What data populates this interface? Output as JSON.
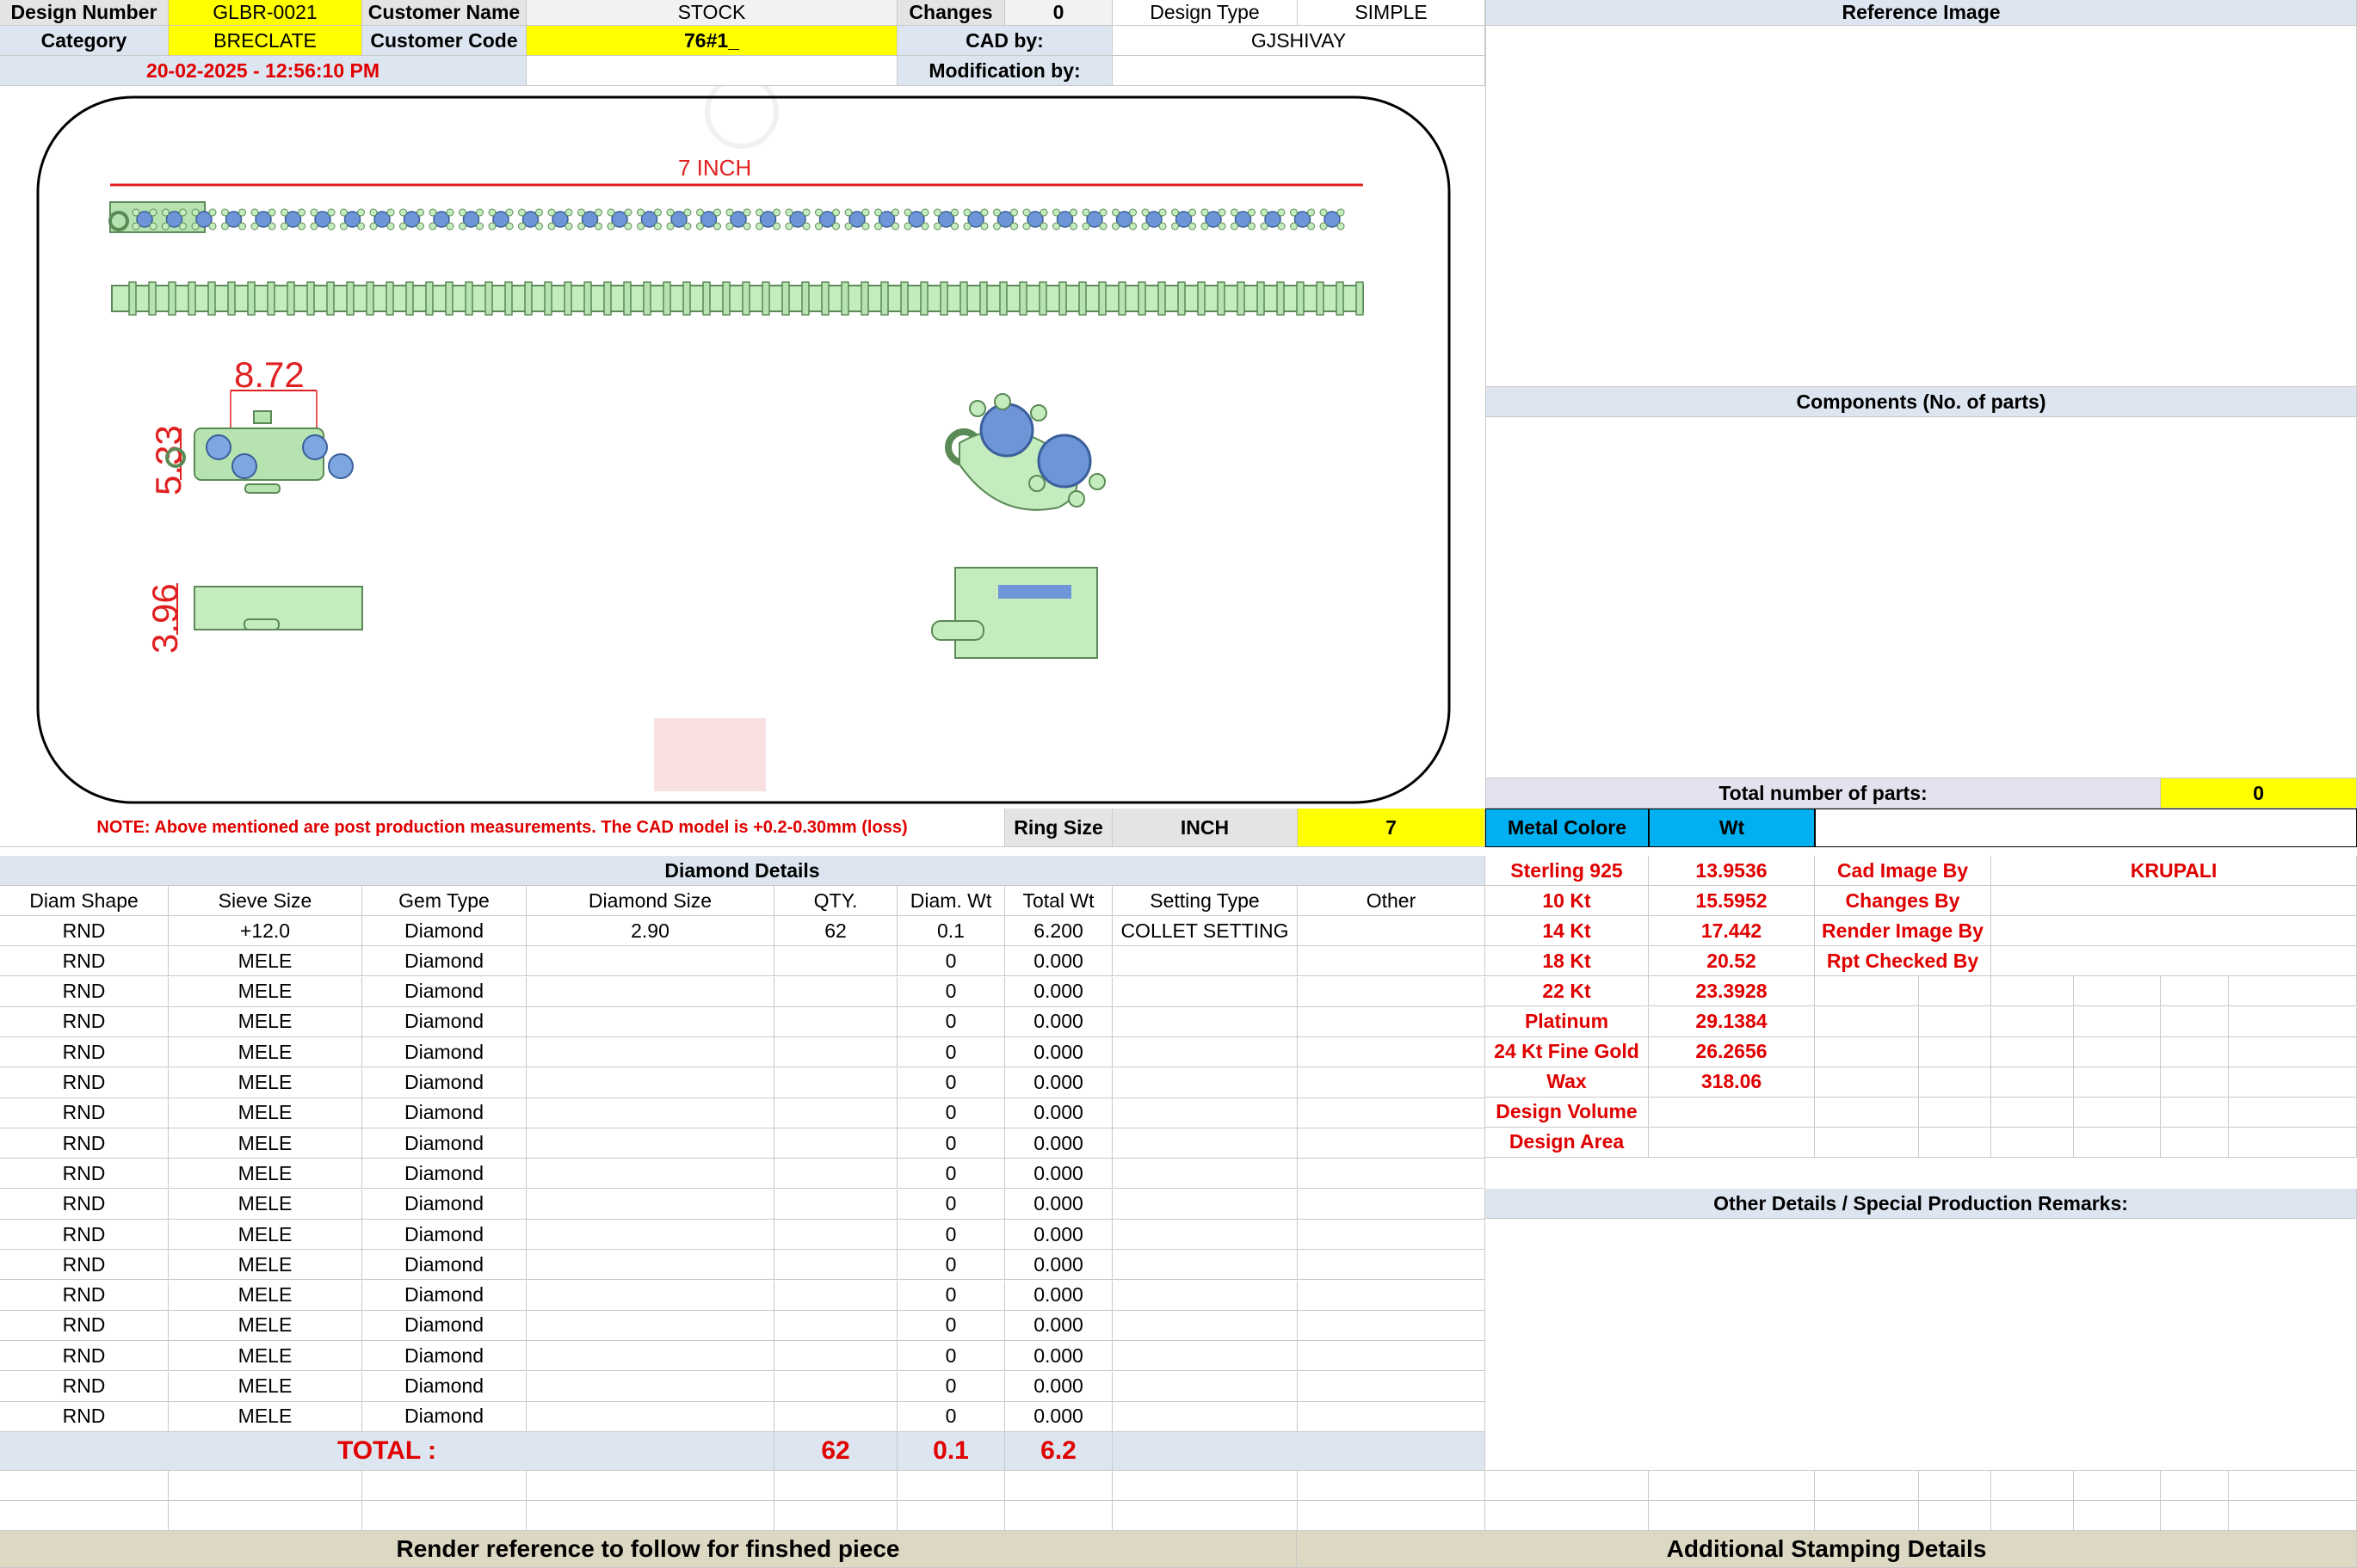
{
  "header": {
    "design_number_label": "Design Number",
    "design_number": "GLBR-0021",
    "customer_name_label": "Customer Name",
    "customer_name": "STOCK",
    "changes_label": "Changes",
    "changes": "0",
    "design_type_label": "Design Type",
    "design_type": "SIMPLE",
    "category_label": "Category",
    "category": "BRECLATE",
    "customer_code_label": "Customer Code",
    "customer_code": "76#1_",
    "cad_by_label": "CAD by:",
    "cad_by": "GJSHIVAY",
    "timestamp": "20-02-2025 - 12:56:10 PM",
    "modification_label": "Modification by:",
    "modification": ""
  },
  "right_panel": {
    "reference_image_title": "Reference Image",
    "components_title": "Components (No. of parts)",
    "total_parts_label": "Total number of parts:",
    "total_parts": "0"
  },
  "drawing": {
    "length_label": "7 INCH",
    "dim_width": "8.72",
    "dim_height": "5.33",
    "dim_thickness": "3.96"
  },
  "note": "NOTE: Above mentioned are post production measurements. The CAD model is +0.2-0.30mm (loss)",
  "ring_size": {
    "label": "Ring Size",
    "unit": "INCH",
    "value": "7"
  },
  "metal": {
    "header_color": "Metal Colore",
    "header_wt": "Wt",
    "rows": [
      {
        "name": "Sterling 925",
        "wt": "13.9536"
      },
      {
        "name": "10 Kt",
        "wt": "15.5952"
      },
      {
        "name": "14 Kt",
        "wt": "17.442"
      },
      {
        "name": "18 Kt",
        "wt": "20.52"
      },
      {
        "name": "22 Kt",
        "wt": "23.3928"
      },
      {
        "name": "Platinum",
        "wt": "29.1384"
      },
      {
        "name": "24 Kt Fine Gold",
        "wt": "26.2656"
      },
      {
        "name": "Wax",
        "wt": "318.06"
      },
      {
        "name": "Design Volume",
        "wt": ""
      },
      {
        "name": "Design Area",
        "wt": ""
      }
    ]
  },
  "credits": [
    {
      "label": "Cad Image By",
      "value": "KRUPALI"
    },
    {
      "label": "Changes By",
      "value": ""
    },
    {
      "label": "Render Image By",
      "value": ""
    },
    {
      "label": "Rpt Checked By",
      "value": ""
    }
  ],
  "other_details_title": "Other Details / Special Production Remarks:",
  "diamond": {
    "title": "Diamond Details",
    "columns": [
      "Diam Shape",
      "Sieve Size",
      "Gem Type",
      "Diamond Size",
      "QTY.",
      "Diam. Wt",
      "Total Wt",
      "Setting Type",
      "Other"
    ],
    "rows": [
      [
        "RND",
        "+12.0",
        "Diamond",
        "2.90",
        "62",
        "0.1",
        "6.200",
        "COLLET SETTING",
        ""
      ],
      [
        "RND",
        "MELE",
        "Diamond",
        "",
        "",
        "0",
        "0.000",
        "",
        ""
      ],
      [
        "RND",
        "MELE",
        "Diamond",
        "",
        "",
        "0",
        "0.000",
        "",
        ""
      ],
      [
        "RND",
        "MELE",
        "Diamond",
        "",
        "",
        "0",
        "0.000",
        "",
        ""
      ],
      [
        "RND",
        "MELE",
        "Diamond",
        "",
        "",
        "0",
        "0.000",
        "",
        ""
      ],
      [
        "RND",
        "MELE",
        "Diamond",
        "",
        "",
        "0",
        "0.000",
        "",
        ""
      ],
      [
        "RND",
        "MELE",
        "Diamond",
        "",
        "",
        "0",
        "0.000",
        "",
        ""
      ],
      [
        "RND",
        "MELE",
        "Diamond",
        "",
        "",
        "0",
        "0.000",
        "",
        ""
      ],
      [
        "RND",
        "MELE",
        "Diamond",
        "",
        "",
        "0",
        "0.000",
        "",
        ""
      ],
      [
        "RND",
        "MELE",
        "Diamond",
        "",
        "",
        "0",
        "0.000",
        "",
        ""
      ],
      [
        "RND",
        "MELE",
        "Diamond",
        "",
        "",
        "0",
        "0.000",
        "",
        ""
      ],
      [
        "RND",
        "MELE",
        "Diamond",
        "",
        "",
        "0",
        "0.000",
        "",
        ""
      ],
      [
        "RND",
        "MELE",
        "Diamond",
        "",
        "",
        "0",
        "0.000",
        "",
        ""
      ],
      [
        "RND",
        "MELE",
        "Diamond",
        "",
        "",
        "0",
        "0.000",
        "",
        ""
      ],
      [
        "RND",
        "MELE",
        "Diamond",
        "",
        "",
        "0",
        "0.000",
        "",
        ""
      ],
      [
        "RND",
        "MELE",
        "Diamond",
        "",
        "",
        "0",
        "0.000",
        "",
        ""
      ],
      [
        "RND",
        "MELE",
        "Diamond",
        "",
        "",
        "0",
        "0.000",
        "",
        ""
      ]
    ],
    "total_label": "TOTAL :",
    "total_qty": "62",
    "total_diam_wt": "0.1",
    "total_wt": "6.2"
  },
  "footer": {
    "render_reference": "Render reference to follow for finshed piece",
    "stamping": "Additional Stamping Details"
  }
}
